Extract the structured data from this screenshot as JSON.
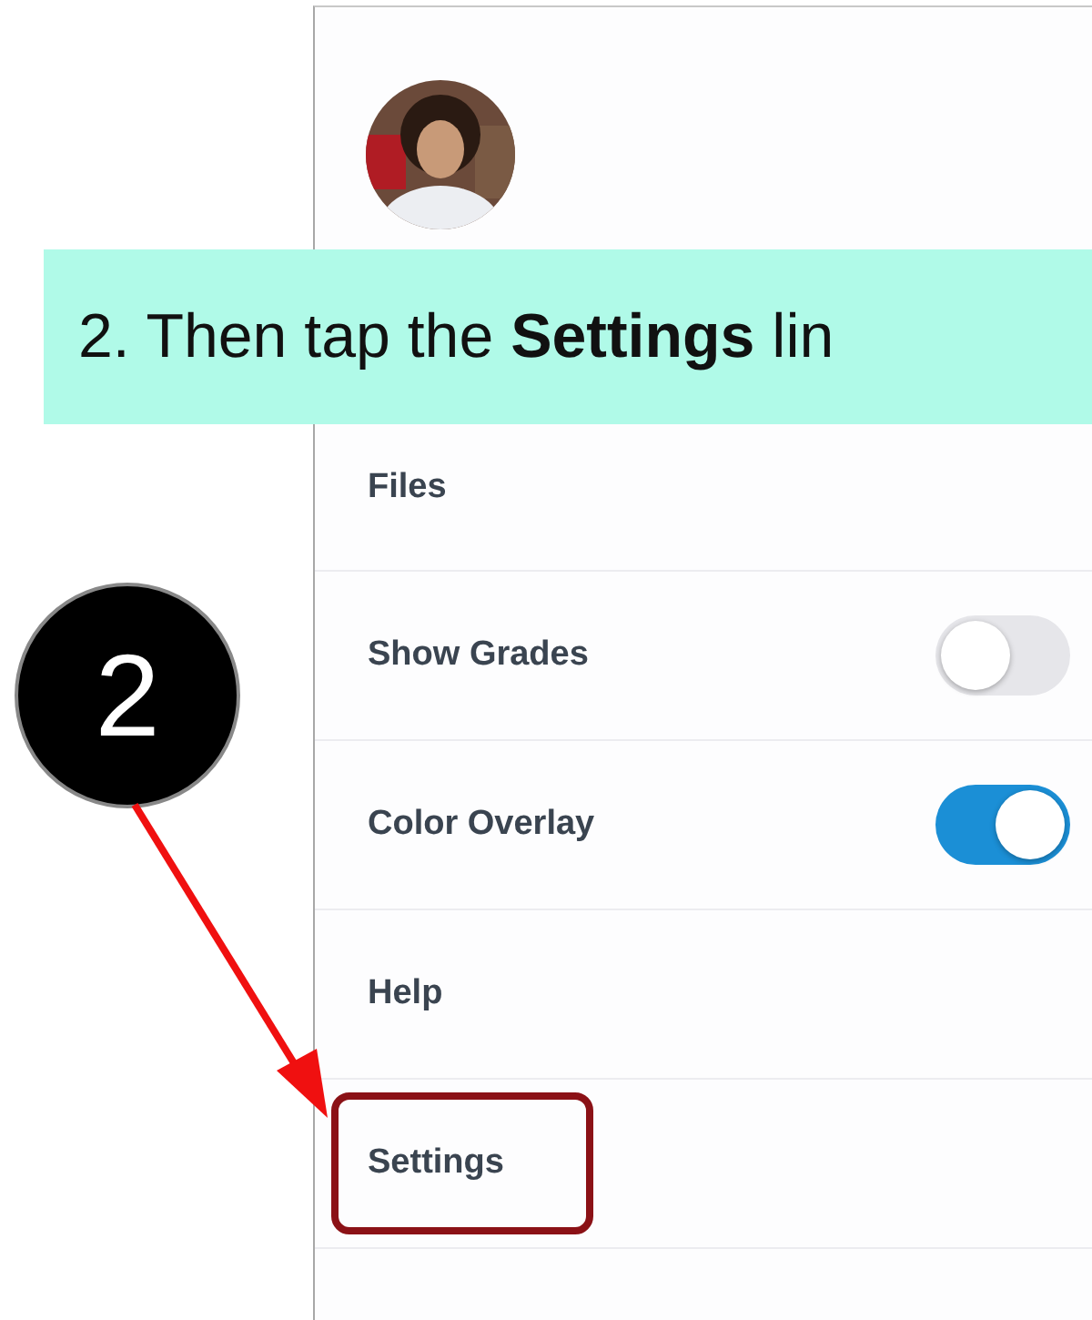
{
  "caption": "2. Then tap the **Settings** lin",
  "step_marker": "2",
  "menu": [
    {
      "label": "Files",
      "kind": "link",
      "highlighted": false
    },
    {
      "label": "Show Grades",
      "kind": "toggle",
      "on": false,
      "highlighted": false
    },
    {
      "label": "Color Overlay",
      "kind": "toggle",
      "on": true,
      "highlighted": false
    },
    {
      "label": "Help",
      "kind": "link",
      "highlighted": false
    },
    {
      "label": "Settings",
      "kind": "link",
      "highlighted": true
    }
  ]
}
